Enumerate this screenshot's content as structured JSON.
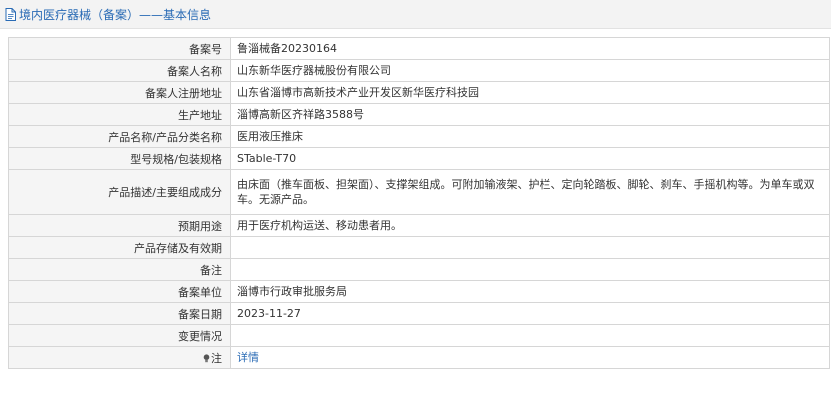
{
  "header": {
    "title": "境内医疗器械（备案）——基本信息"
  },
  "rows": [
    {
      "label": "备案号",
      "value": "鲁淄械备20230164"
    },
    {
      "label": "备案人名称",
      "value": "山东新华医疗器械股份有限公司"
    },
    {
      "label": "备案人注册地址",
      "value": "山东省淄博市高新技术产业开发区新华医疗科技园"
    },
    {
      "label": "生产地址",
      "value": "淄博高新区齐祥路3588号"
    },
    {
      "label": "产品名称/产品分类名称",
      "value": "医用液压推床"
    },
    {
      "label": "型号规格/包装规格",
      "value": "STable-T70"
    },
    {
      "label": "产品描述/主要组成成分",
      "value": "由床面（推车面板、担架面）、支撑架组成。可附加输液架、护栏、定向轮踏板、脚轮、刹车、手摇机构等。为单车或双车。无源产品。"
    },
    {
      "label": "预期用途",
      "value": "用于医疗机构运送、移动患者用。"
    },
    {
      "label": "产品存储及有效期",
      "value": ""
    },
    {
      "label": "备注",
      "value": ""
    },
    {
      "label": "备案单位",
      "value": "淄博市行政审批服务局"
    },
    {
      "label": "备案日期",
      "value": "2023-11-27"
    },
    {
      "label": "变更情况",
      "value": ""
    },
    {
      "label": "注",
      "value": "详情"
    }
  ],
  "icons": {
    "header_icon": "document-icon",
    "note_icon": "lightbulb-icon"
  },
  "colors": {
    "link": "#2a6bb5",
    "label_bg": "#f5f5f5",
    "border": "#d6d6d6",
    "header_bg": "#f3f3f3"
  }
}
